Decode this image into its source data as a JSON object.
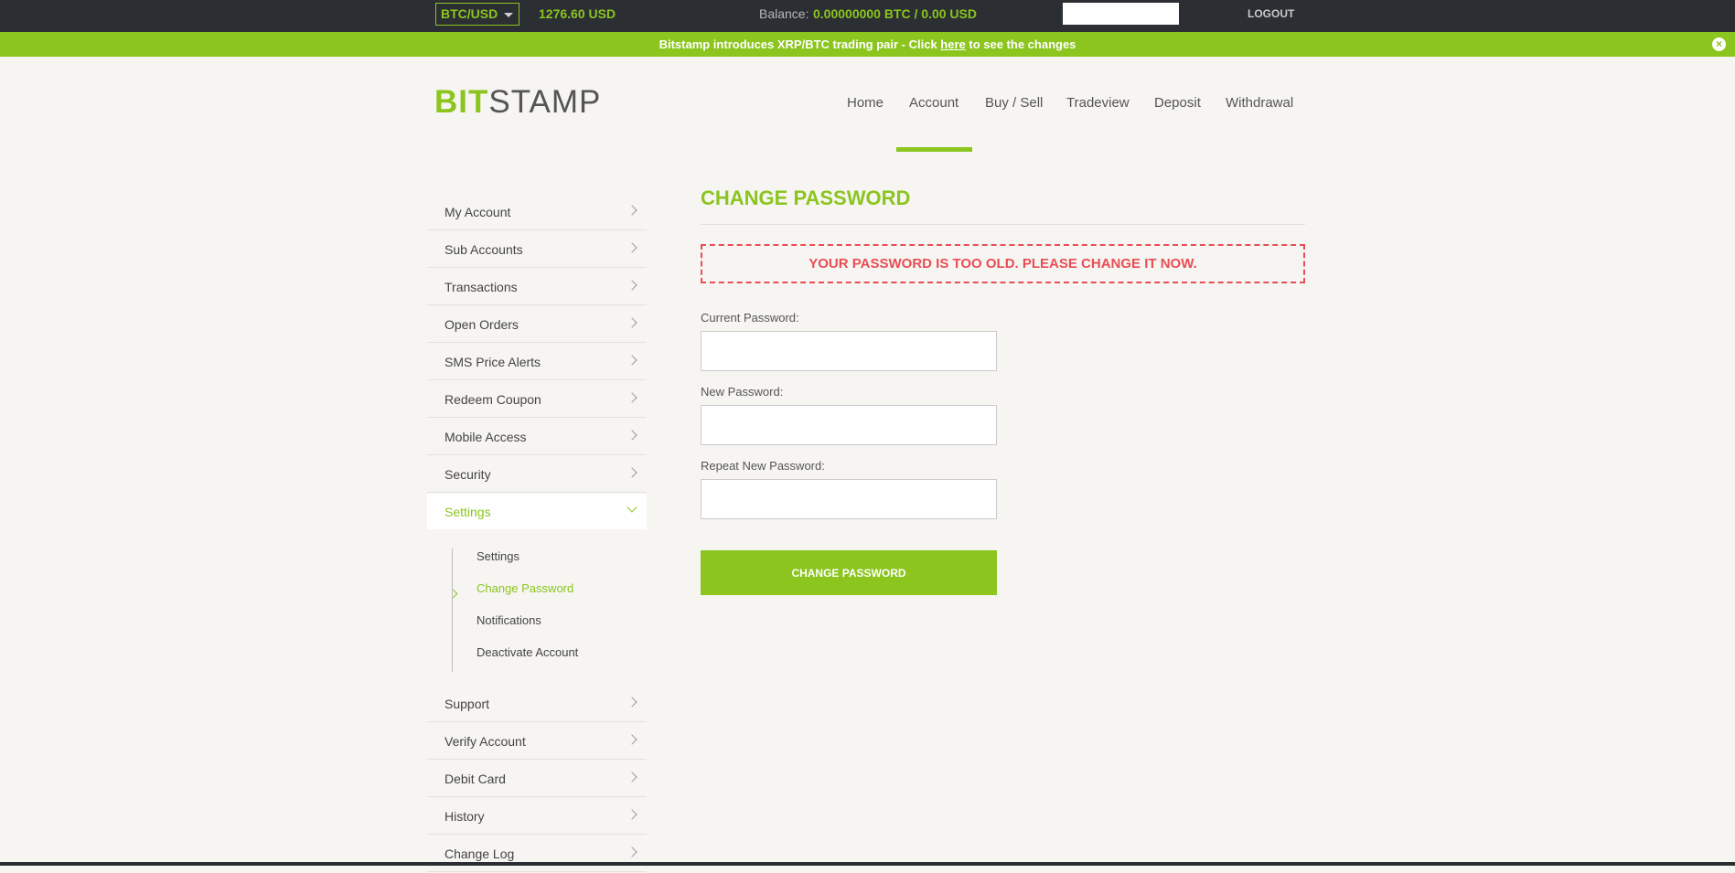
{
  "topbar": {
    "pair": "BTC/USD",
    "price": "1276.60 USD",
    "balance_label": "Balance:",
    "balance_value": "0.00000000 BTC / 0.00 USD",
    "logout": "LOGOUT"
  },
  "announcement": {
    "text_before": "Bitstamp introduces XRP/BTC trading pair - Click ",
    "link": "here",
    "text_after": " to see the changes",
    "close_glyph": "×"
  },
  "logo": {
    "part1": "BIT",
    "part2": "STAMP"
  },
  "nav": [
    {
      "label": "Home"
    },
    {
      "label": "Account"
    },
    {
      "label": "Buy / Sell"
    },
    {
      "label": "Tradeview"
    },
    {
      "label": "Deposit"
    },
    {
      "label": "Withdrawal"
    }
  ],
  "sidebar": {
    "items_top": [
      {
        "label": "My Account"
      },
      {
        "label": "Sub Accounts"
      },
      {
        "label": "Transactions"
      },
      {
        "label": "Open Orders"
      },
      {
        "label": "SMS Price Alerts"
      },
      {
        "label": "Redeem Coupon"
      },
      {
        "label": "Mobile Access"
      },
      {
        "label": "Security"
      }
    ],
    "active": {
      "label": "Settings"
    },
    "sub_items": [
      {
        "label": "Settings"
      },
      {
        "label": "Change Password"
      },
      {
        "label": "Notifications"
      },
      {
        "label": "Deactivate Account"
      }
    ],
    "items_bottom": [
      {
        "label": "Support"
      },
      {
        "label": "Verify Account"
      },
      {
        "label": "Debit Card"
      },
      {
        "label": "History"
      },
      {
        "label": "Change Log"
      }
    ]
  },
  "main": {
    "title": "CHANGE PASSWORD",
    "alert": "YOUR PASSWORD IS TOO OLD. PLEASE CHANGE IT NOW.",
    "current_label": "Current Password:",
    "new_label": "New Password:",
    "repeat_label": "Repeat New Password:",
    "submit": "CHANGE PASSWORD"
  },
  "colors": {
    "accent": "#8bc51e",
    "alert": "#e84e55",
    "topbar": "#2b2e33",
    "background": "#f6f5f2"
  }
}
